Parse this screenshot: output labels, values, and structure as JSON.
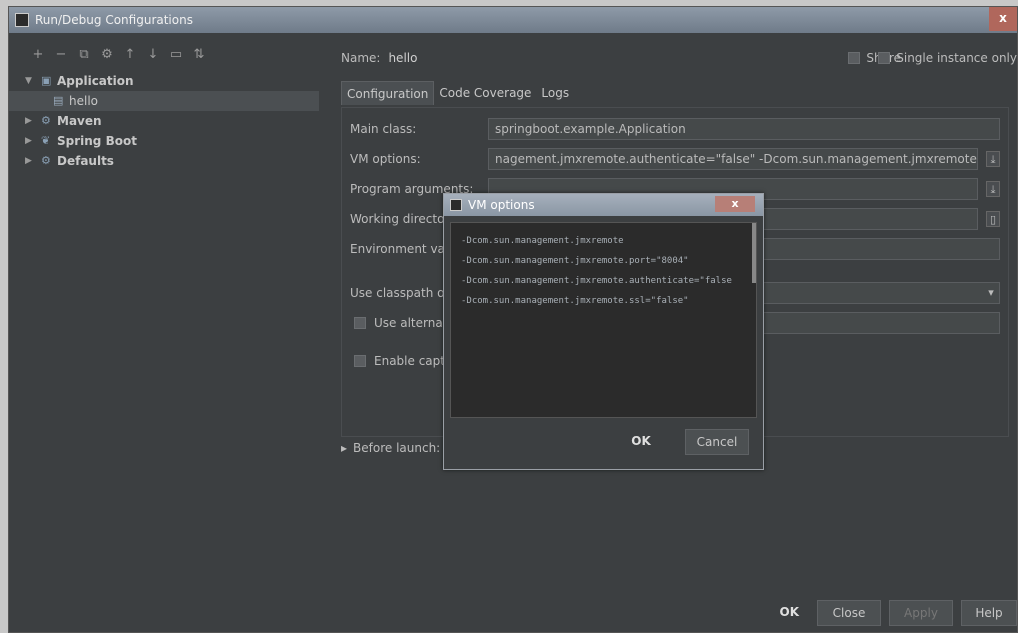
{
  "window": {
    "title": "Run/Debug Configurations",
    "close_label": "x"
  },
  "toolbar": {
    "icons": [
      "+",
      "−",
      "⧉",
      "⚙",
      "↑",
      "↓",
      "▭",
      "⇅"
    ]
  },
  "tree": {
    "application": "Application",
    "hello": "hello",
    "maven": "Maven",
    "spring_boot": "Spring Boot",
    "defaults": "Defaults"
  },
  "header": {
    "name_label": "Name:",
    "name_value": "hello",
    "share_label": "Share",
    "single_instance_label": "Single instance only"
  },
  "tabs": [
    "Configuration",
    "Code Coverage",
    "Logs"
  ],
  "form": {
    "main_class_label": "Main class:",
    "main_class_value": "springboot.example.Application",
    "vm_options_label": "VM options:",
    "vm_options_value": "nagement.jmxremote.authenticate=\"false\" -Dcom.sun.management.jmxremote.ssl=\"false\"",
    "program_arguments_label": "Program arguments:",
    "working_directory_label": "Working directory",
    "environment_label": "Environment variat",
    "classpath_label": "Use classpath of m",
    "use_alternative_label": "Use alternativ",
    "enable_capture_label": "Enable captur",
    "before_launch_label": "Before launch: Mak"
  },
  "buttons": {
    "ok": "OK",
    "close": "Close",
    "apply": "Apply",
    "help": "Help"
  },
  "dialog": {
    "title": "VM options",
    "close_label": "x",
    "lines": [
      "-Dcom.sun.management.jmxremote",
      "-Dcom.sun.management.jmxremote.port=\"8004\"",
      "-Dcom.sun.management.jmxremote.authenticate=\"false",
      "-Dcom.sun.management.jmxremote.ssl=\"false\""
    ],
    "ok": "OK",
    "cancel": "Cancel"
  }
}
